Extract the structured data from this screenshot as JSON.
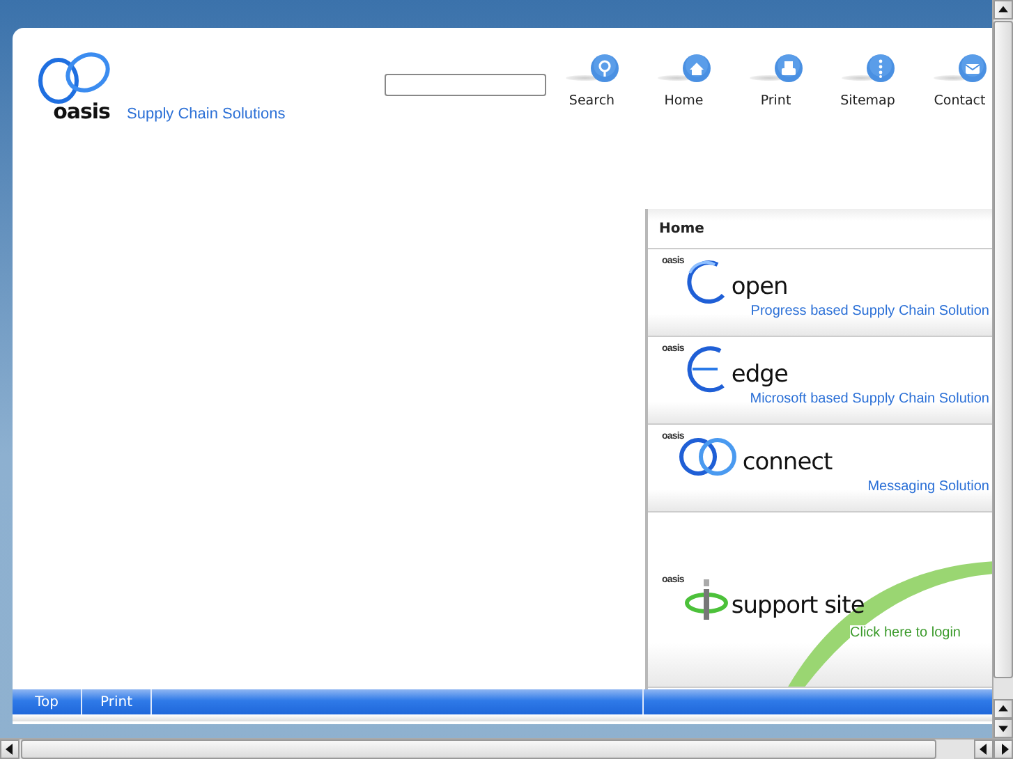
{
  "logo": {
    "wordmark": "oasis",
    "tagline": "Supply Chain Solutions"
  },
  "nav": [
    {
      "kind": "search",
      "label": "Search"
    },
    {
      "kind": "home",
      "label": "Home"
    },
    {
      "kind": "print",
      "label": "Print"
    },
    {
      "kind": "sitemap",
      "label": "Sitemap"
    },
    {
      "kind": "contact",
      "label": "Contact"
    }
  ],
  "panel": {
    "title": "Home",
    "products": [
      {
        "kind": "open",
        "brand": "oasis",
        "name": "open",
        "tagline": "Progress based Supply Chain Solution"
      },
      {
        "kind": "edge",
        "brand": "oasis",
        "name": "edge",
        "tagline": "Microsoft based Supply Chain Solution"
      },
      {
        "kind": "connect",
        "brand": "oasis",
        "name": "connect",
        "tagline": "Messaging Solution"
      },
      {
        "kind": "support",
        "brand": "oasis",
        "name": "support site",
        "tagline": "Click here to login"
      }
    ]
  },
  "footer": {
    "links": [
      "Top",
      "Print"
    ]
  }
}
